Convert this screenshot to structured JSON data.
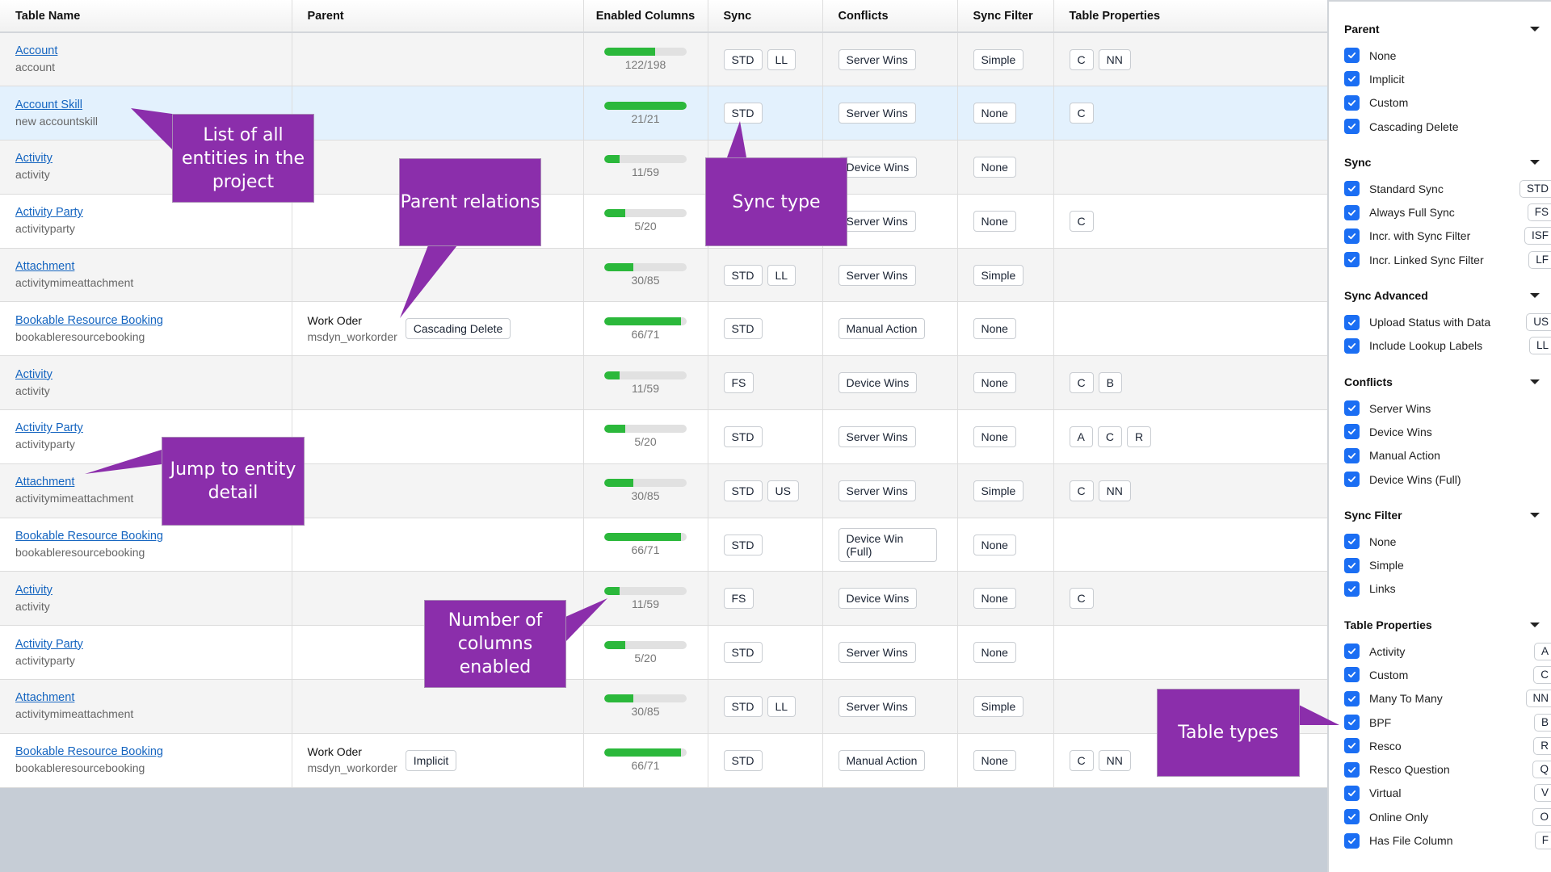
{
  "table": {
    "headers": {
      "name": "Table Name",
      "parent": "Parent",
      "columns": "Enabled Columns",
      "sync": "Sync",
      "conflicts": "Conflicts",
      "sync_filter": "Sync Filter",
      "properties": "Table Properties"
    },
    "rows": [
      {
        "name": "Account",
        "logical": "account",
        "parent": null,
        "enabled": 122,
        "total": 198,
        "sync": [
          "STD",
          "LL"
        ],
        "conflict": "Server Wins",
        "filter": "Simple",
        "props": [
          "C",
          "NN"
        ],
        "selected": false
      },
      {
        "name": "Account Skill",
        "logical": "new accountskill",
        "parent": null,
        "enabled": 21,
        "total": 21,
        "sync": [
          "STD"
        ],
        "conflict": "Server Wins",
        "filter": "None",
        "props": [
          "C"
        ],
        "selected": true
      },
      {
        "name": "Activity",
        "logical": "activity",
        "parent": null,
        "enabled": 11,
        "total": 59,
        "sync": [],
        "conflict": "Device Wins",
        "filter": "None",
        "props": [],
        "selected": false
      },
      {
        "name": "Activity Party",
        "logical": "activityparty",
        "parent": null,
        "enabled": 5,
        "total": 20,
        "sync": [],
        "conflict": "Server Wins",
        "filter": "None",
        "props": [
          "C"
        ],
        "selected": false
      },
      {
        "name": "Attachment",
        "logical": "activitymimeattachment",
        "parent": null,
        "enabled": 30,
        "total": 85,
        "sync": [
          "STD",
          "LL"
        ],
        "conflict": "Server Wins",
        "filter": "Simple",
        "props": [],
        "selected": false
      },
      {
        "name": "Bookable Resource Booking",
        "logical": "bookableresourcebooking",
        "parent": {
          "name": "Work Oder",
          "logical": "msdyn_workorder",
          "relation": "Cascading Delete"
        },
        "enabled": 66,
        "total": 71,
        "sync": [
          "STD"
        ],
        "conflict": "Manual Action",
        "filter": "None",
        "props": [],
        "selected": false
      },
      {
        "name": "Activity",
        "logical": "activity",
        "parent": null,
        "enabled": 11,
        "total": 59,
        "sync": [
          "FS"
        ],
        "conflict": "Device Wins",
        "filter": "None",
        "props": [
          "C",
          "B"
        ],
        "selected": false
      },
      {
        "name": "Activity Party",
        "logical": "activityparty",
        "parent": null,
        "enabled": 5,
        "total": 20,
        "sync": [
          "STD"
        ],
        "conflict": "Server Wins",
        "filter": "None",
        "props": [
          "A",
          "C",
          "R"
        ],
        "selected": false
      },
      {
        "name": "Attachment",
        "logical": "activitymimeattachment",
        "parent": null,
        "enabled": 30,
        "total": 85,
        "sync": [
          "STD",
          "US"
        ],
        "conflict": "Server Wins",
        "filter": "Simple",
        "props": [
          "C",
          "NN"
        ],
        "selected": false
      },
      {
        "name": "Bookable Resource Booking",
        "logical": "bookableresourcebooking",
        "parent": null,
        "enabled": 66,
        "total": 71,
        "sync": [
          "STD"
        ],
        "conflict": "Device Win (Full)",
        "filter": "None",
        "props": [],
        "selected": false
      },
      {
        "name": "Activity",
        "logical": "activity",
        "parent": null,
        "enabled": 11,
        "total": 59,
        "sync": [
          "FS"
        ],
        "conflict": "Device Wins",
        "filter": "None",
        "props": [
          "C"
        ],
        "selected": false
      },
      {
        "name": "Activity Party",
        "logical": "activityparty",
        "parent": null,
        "enabled": 5,
        "total": 20,
        "sync": [
          "STD"
        ],
        "conflict": "Server Wins",
        "filter": "None",
        "props": [],
        "selected": false
      },
      {
        "name": "Attachment",
        "logical": "activitymimeattachment",
        "parent": null,
        "enabled": 30,
        "total": 85,
        "sync": [
          "STD",
          "LL"
        ],
        "conflict": "Server Wins",
        "filter": "Simple",
        "props": [],
        "selected": false
      },
      {
        "name": "Bookable Resource Booking",
        "logical": "bookableresourcebooking",
        "parent": {
          "name": "Work Oder",
          "logical": "msdyn_workorder",
          "relation": "Implicit"
        },
        "enabled": 66,
        "total": 71,
        "sync": [
          "STD"
        ],
        "conflict": "Manual Action",
        "filter": "None",
        "props": [
          "C",
          "NN"
        ],
        "selected": false
      }
    ]
  },
  "filters": [
    {
      "title": "Parent",
      "options": [
        {
          "label": "None",
          "checked": true
        },
        {
          "label": "Implicit",
          "checked": true
        },
        {
          "label": "Custom",
          "checked": true
        },
        {
          "label": "Cascading Delete",
          "checked": true
        }
      ]
    },
    {
      "title": "Sync",
      "options": [
        {
          "label": "Standard Sync",
          "code": "STD",
          "checked": true
        },
        {
          "label": "Always Full Sync",
          "code": "FS",
          "checked": true
        },
        {
          "label": "Incr. with Sync Filter",
          "code": "ISF",
          "checked": true
        },
        {
          "label": "Incr. Linked Sync Filter",
          "code": "LF",
          "checked": true
        }
      ]
    },
    {
      "title": "Sync Advanced",
      "options": [
        {
          "label": "Upload Status with Data",
          "code": "US",
          "checked": true
        },
        {
          "label": "Include Lookup Labels",
          "code": "LL",
          "checked": true
        }
      ]
    },
    {
      "title": "Conflicts",
      "options": [
        {
          "label": "Server Wins",
          "checked": true
        },
        {
          "label": "Device Wins",
          "checked": true
        },
        {
          "label": "Manual Action",
          "checked": true
        },
        {
          "label": "Device Wins (Full)",
          "checked": true
        }
      ]
    },
    {
      "title": "Sync Filter",
      "options": [
        {
          "label": "None",
          "checked": true
        },
        {
          "label": "Simple",
          "checked": true
        },
        {
          "label": "Links",
          "checked": true
        }
      ]
    },
    {
      "title": "Table Properties",
      "options": [
        {
          "label": "Activity",
          "code": "A",
          "checked": true
        },
        {
          "label": "Custom",
          "code": "C",
          "checked": true
        },
        {
          "label": "Many To Many",
          "code": "NN",
          "checked": true
        },
        {
          "label": "BPF",
          "code": "B",
          "checked": true
        },
        {
          "label": "Resco",
          "code": "R",
          "checked": true
        },
        {
          "label": "Resco Question",
          "code": "Q",
          "checked": true
        },
        {
          "label": "Virtual",
          "code": "V",
          "checked": true
        },
        {
          "label": "Online Only",
          "code": "O",
          "checked": true
        },
        {
          "label": "Has File Column",
          "code": "F",
          "checked": true
        }
      ]
    }
  ],
  "callouts": {
    "entities": "List of all entities in the project",
    "parent": "Parent relations",
    "sync": "Sync type",
    "jump": "Jump to entity detail",
    "columns": "Number of columns enabled",
    "types": "Table types"
  },
  "colors": {
    "accent": "#1b6ef3",
    "link": "#1565c0",
    "progress": "#2bb83b",
    "selected_row": "#e3f1fd",
    "callout": "#8b2eab"
  }
}
